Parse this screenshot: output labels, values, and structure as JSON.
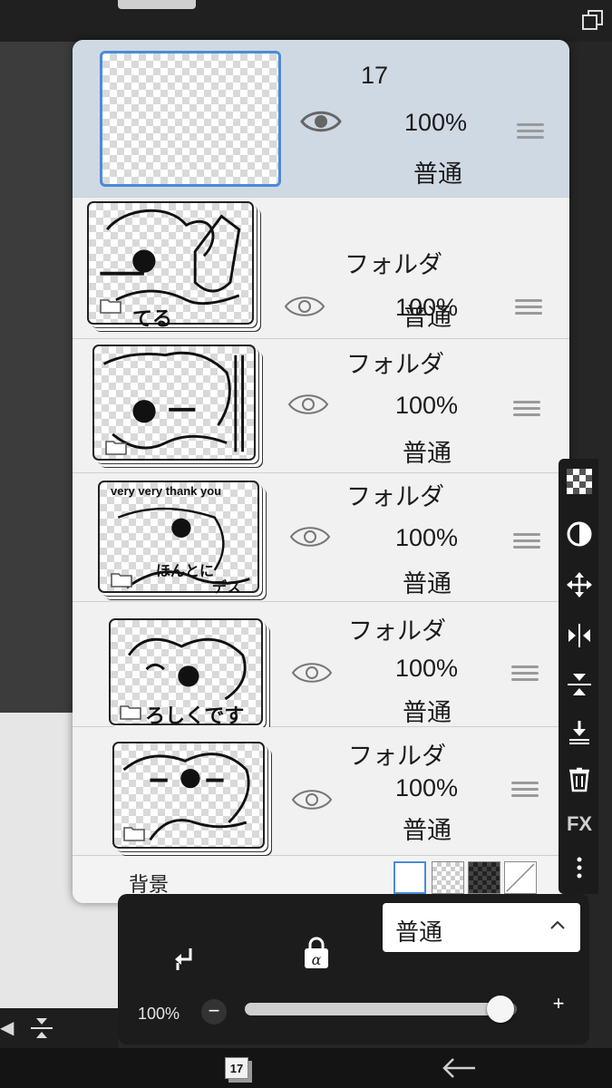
{
  "top_layer": {
    "name": "17",
    "opacity": "100%",
    "blend": "普通"
  },
  "folders": [
    {
      "name": "フォルダ",
      "opacity": "100%",
      "blend": "普通",
      "thumb_text": "てる"
    },
    {
      "name": "フォルダ",
      "opacity": "100%",
      "blend": "普通",
      "thumb_text": ""
    },
    {
      "name": "フォルダ",
      "opacity": "100%",
      "blend": "普通",
      "thumb_text": "very very thank you",
      "thumb_text2": "ほんとに",
      "thumb_text3": "デス"
    },
    {
      "name": "フォルダ",
      "opacity": "100%",
      "blend": "普通",
      "thumb_text": "ろしくです"
    },
    {
      "name": "フォルダ",
      "opacity": "100%",
      "blend": "普通",
      "thumb_text": ""
    }
  ],
  "background": {
    "label": "背景"
  },
  "tools": {
    "fx_label": "FX"
  },
  "bottom": {
    "blend_mode": "普通",
    "opacity_label": "100%",
    "opacity_value": 1.0,
    "minus": "−",
    "plus": "+"
  },
  "nav": {
    "page_count": "17"
  },
  "colors": {
    "selection_accent": "#4b8bd6",
    "selected_row": "#cfd9e4"
  },
  "icons": [
    "eye-icon",
    "drag-handle-icon",
    "folder-icon",
    "checker-icon",
    "contrast-icon",
    "move-icon",
    "flip-horizontal-icon",
    "flip-vertical-icon",
    "merge-down-icon",
    "trash-icon",
    "more-icon",
    "clip-icon",
    "alpha-lock-icon",
    "chevron-up-icon",
    "back-arrow-icon"
  ]
}
